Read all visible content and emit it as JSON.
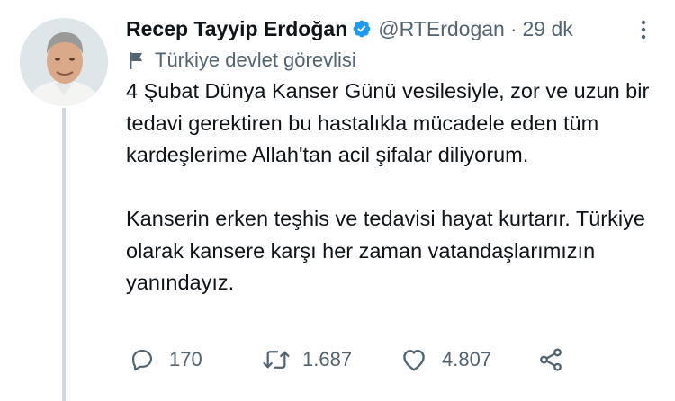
{
  "tweet": {
    "author": {
      "name": "Recep Tayyip Erdoğan",
      "handle": "@RTErdogan",
      "verified": true,
      "avatar_icon": "profile-photo"
    },
    "separator": "·",
    "time": "29 dk",
    "account_label": {
      "icon": "flag-icon",
      "text": "Türkiye devlet görevlisi"
    },
    "paragraphs": [
      "4 Şubat Dünya Kanser Günü vesilesiyle, zor ve uzun bir tedavi gerektiren bu hastalıkla mücadele eden tüm kardeşlerime Allah'tan acil şifalar diliyorum.",
      "Kanserin erken teşhis ve tedavisi hayat kurtarır. Türkiye olarak kansere karşı her zaman vatandaşlarımızın yanındayız."
    ],
    "actions": {
      "reply": {
        "icon": "reply-icon",
        "count": "170"
      },
      "retweet": {
        "icon": "retweet-icon",
        "count": "1.687"
      },
      "like": {
        "icon": "heart-icon",
        "count": "4.807"
      },
      "share": {
        "icon": "share-icon"
      }
    }
  },
  "colors": {
    "text": "#0f1419",
    "secondary": "#536471",
    "verified": "#1d9bf0",
    "thread_line": "#cfd9de"
  }
}
